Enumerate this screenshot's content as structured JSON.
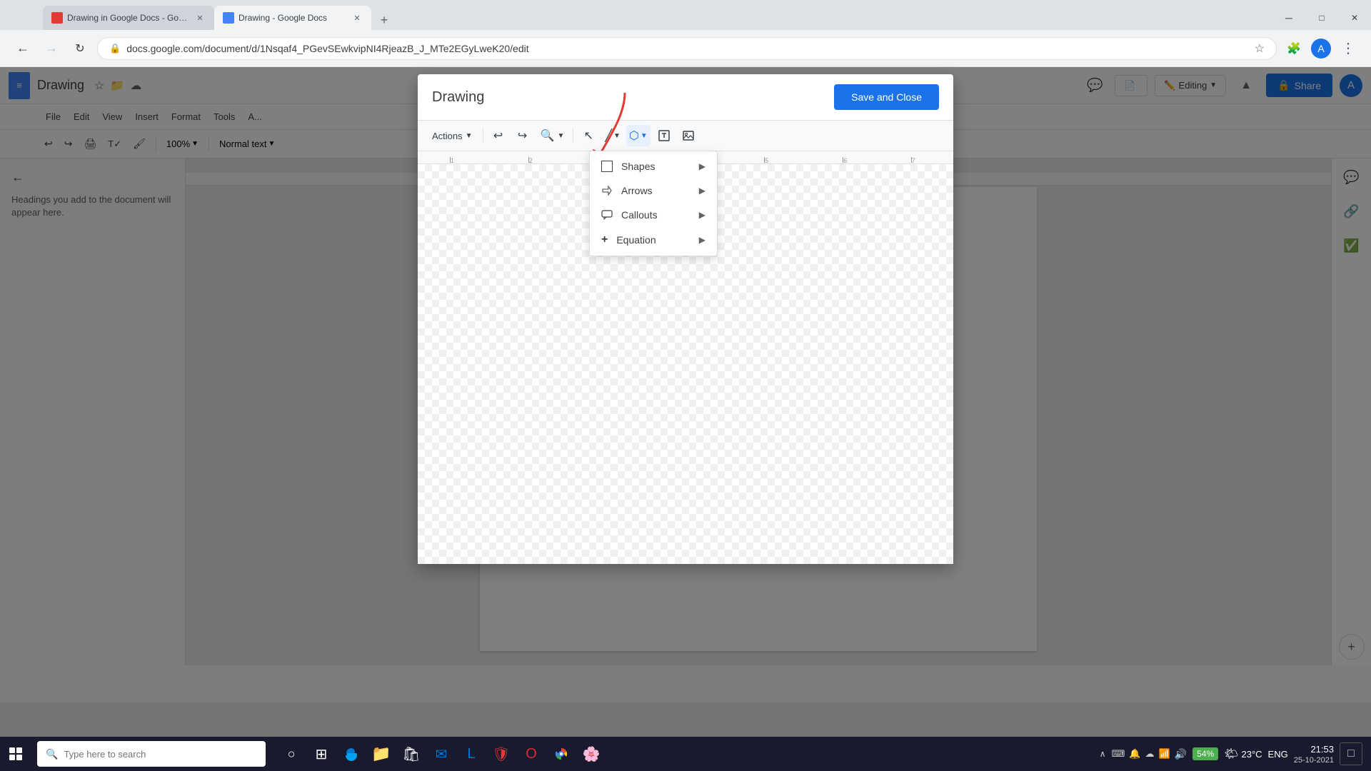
{
  "browser": {
    "tabs": [
      {
        "id": "tab1",
        "title": "Drawing in Google Docs - Goog...",
        "active": false,
        "favicon_color": "#e53935"
      },
      {
        "id": "tab2",
        "title": "Drawing - Google Docs",
        "active": true,
        "favicon_color": "#4285f4"
      }
    ],
    "url": "docs.google.com/document/d/1Nsqaf4_PGevSEwkvipNI4RjeazB_J_MTe2EGyLweK20/edit",
    "profile_letter": "A"
  },
  "docs": {
    "title": "Drawing",
    "menus": [
      "File",
      "Edit",
      "View",
      "Insert",
      "Format",
      "Tools",
      "A..."
    ],
    "editing_mode": "Editing",
    "zoom": "100%",
    "style": "Normal text"
  },
  "drawing_modal": {
    "title": "Drawing",
    "save_close_label": "Save and Close",
    "toolbar": {
      "actions_label": "Actions",
      "undo_label": "↩",
      "redo_label": "↪",
      "zoom_label": "🔍",
      "tools": [
        {
          "name": "select",
          "label": "↖",
          "active": false
        },
        {
          "name": "line",
          "label": "╱",
          "active": false
        },
        {
          "name": "shape",
          "label": "⬡",
          "active": true
        },
        {
          "name": "text-box",
          "label": "⬜",
          "active": false
        },
        {
          "name": "image",
          "label": "🖼",
          "active": false
        }
      ]
    },
    "dropdown_menu": {
      "items": [
        {
          "label": "Shapes",
          "icon": "□",
          "has_submenu": true
        },
        {
          "label": "Arrows",
          "icon": "→",
          "has_submenu": true
        },
        {
          "label": "Callouts",
          "icon": "💬",
          "has_submenu": true
        },
        {
          "label": "Equation",
          "icon": "+",
          "has_submenu": true
        }
      ]
    }
  },
  "taskbar": {
    "search_placeholder": "Type here to search",
    "time": "21:53",
    "date": "25-10-2021",
    "temperature": "23°C",
    "battery": "54%",
    "language": "ENG"
  },
  "sidebar": {
    "outline_text": "Headings you add to the document will appear here."
  }
}
